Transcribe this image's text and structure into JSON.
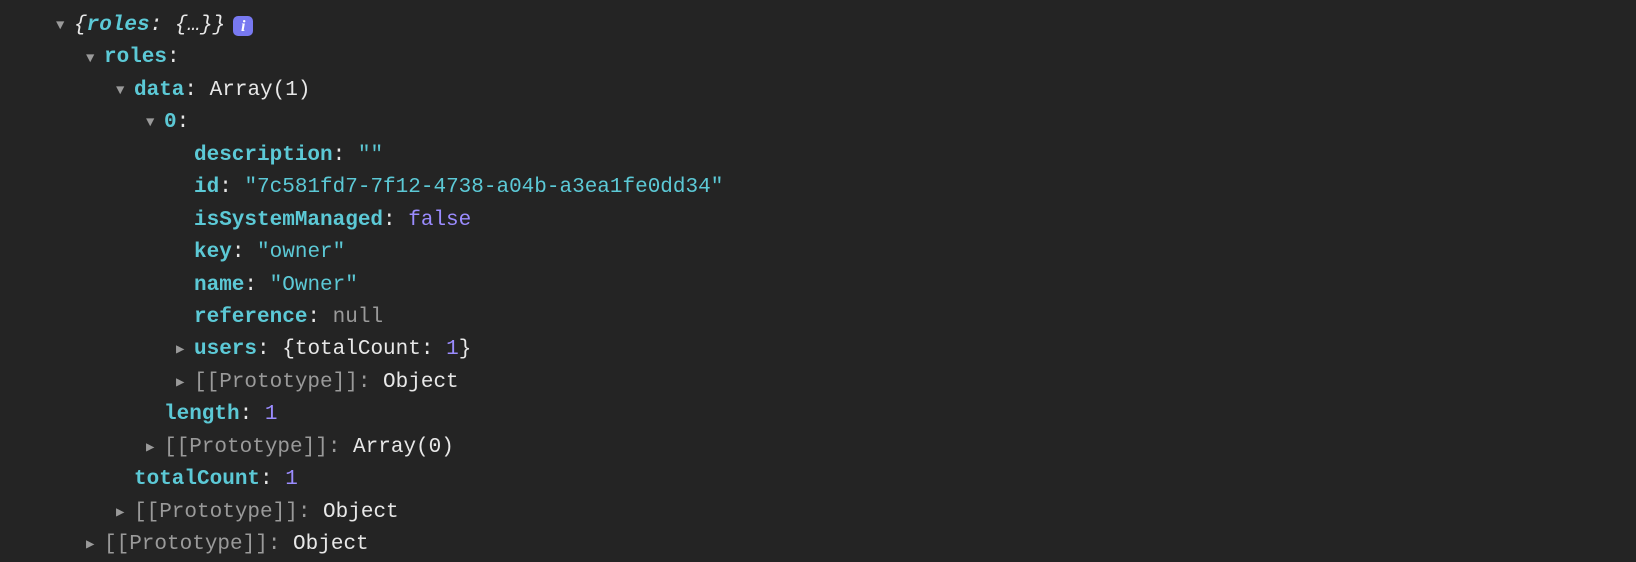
{
  "header": {
    "summary_open": "{",
    "summary_key": "roles",
    "summary_val": "{…}",
    "summary_close": "}",
    "info_badge": "i"
  },
  "roles": {
    "label": "roles",
    "data_label": "data",
    "data_type": "Array(1)",
    "item0_label": "0",
    "props": {
      "description_key": "description",
      "description_val": "\"\"",
      "id_key": "id",
      "id_val": "\"7c581fd7-7f12-4738-a04b-a3ea1fe0dd34\"",
      "isSystemManaged_key": "isSystemManaged",
      "isSystemManaged_val": "false",
      "key_key": "key",
      "key_val": "\"owner\"",
      "name_key": "name",
      "name_val": "\"Owner\"",
      "reference_key": "reference",
      "reference_val": "null",
      "users_key": "users",
      "users_summary_open": "{",
      "users_inner_key": "totalCount",
      "users_inner_val": "1",
      "users_summary_close": "}",
      "proto_item_key": "[[Prototype]]",
      "proto_item_val": "Object"
    },
    "length_key": "length",
    "length_val": "1",
    "proto_array_key": "[[Prototype]]",
    "proto_array_val": "Array(0)",
    "totalCount_key": "totalCount",
    "totalCount_val": "1",
    "proto_roles_key": "[[Prototype]]",
    "proto_roles_val": "Object"
  },
  "proto_root_key": "[[Prototype]]",
  "proto_root_val": "Object"
}
